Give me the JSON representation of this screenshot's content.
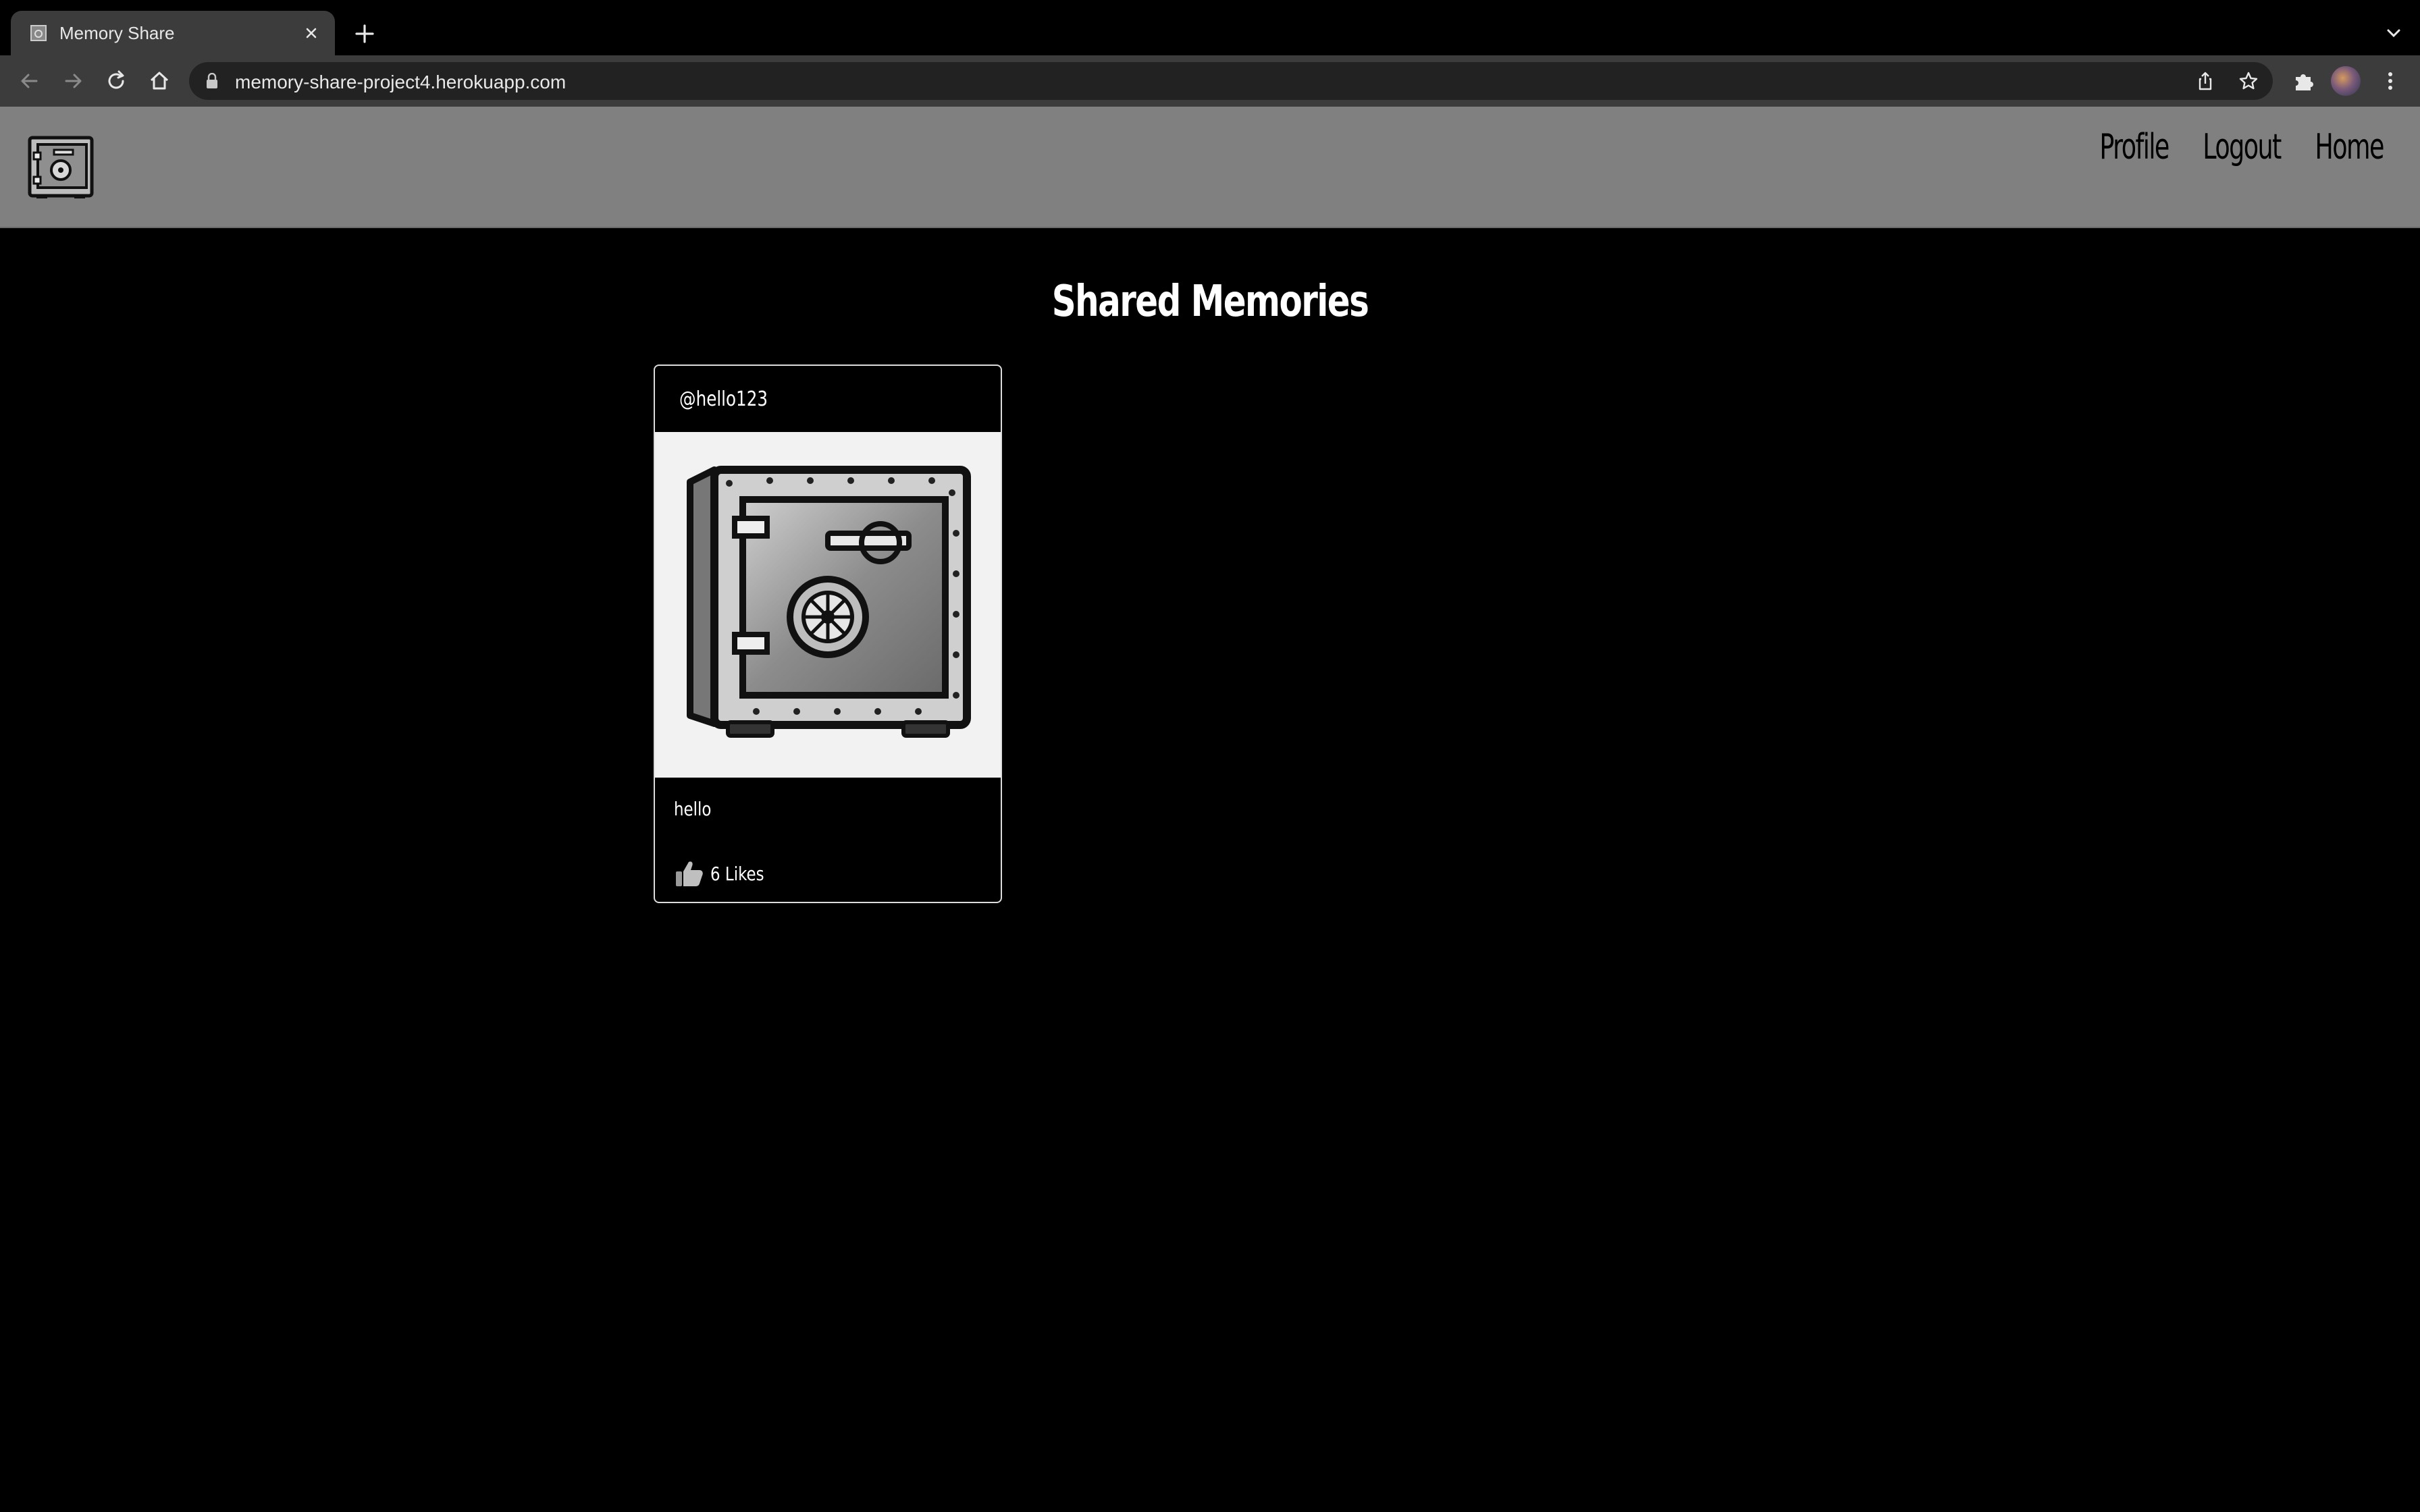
{
  "browser": {
    "tab_title": "Memory Share",
    "url": "memory-share-project4.herokuapp.com"
  },
  "site": {
    "nav": [
      {
        "label": "Profile"
      },
      {
        "label": "Logout"
      },
      {
        "label": "Home"
      }
    ],
    "logo_icon": "safe-icon"
  },
  "main": {
    "title": "Shared Memories",
    "posts": [
      {
        "author": "@hello123",
        "image_icon": "safe-illustration",
        "text": "hello",
        "likes_label": "6 Likes",
        "like_icon": "thumbs-up-icon"
      }
    ]
  },
  "colors": {
    "header_bg": "#808080",
    "page_bg": "#000000",
    "card_border": "#dcdcdc"
  }
}
